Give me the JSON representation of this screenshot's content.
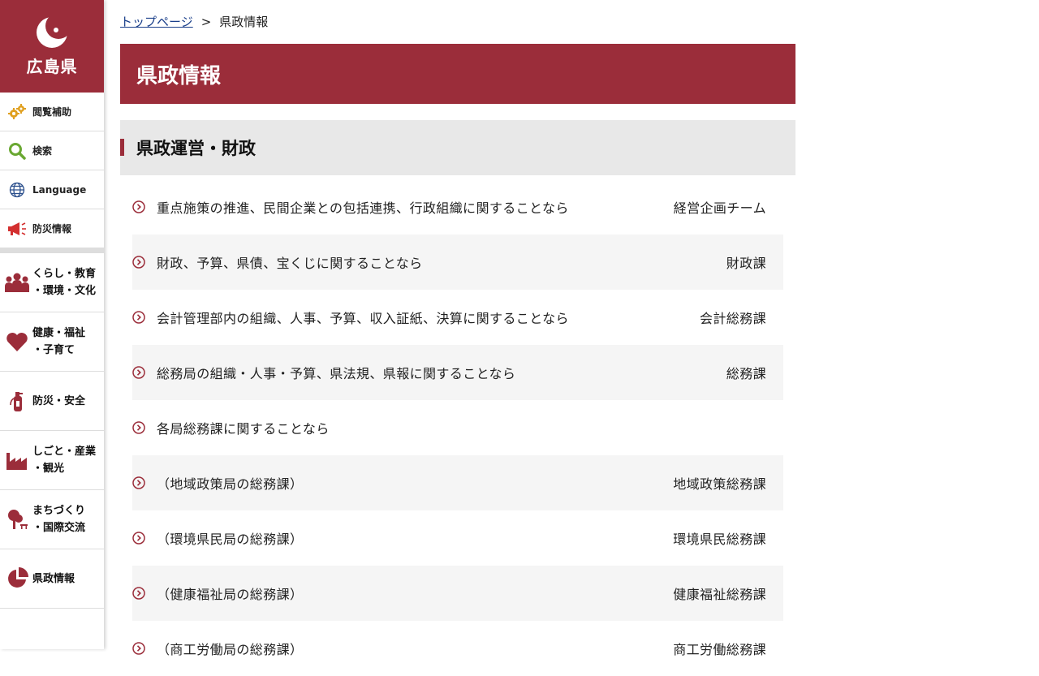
{
  "logo": {
    "name": "広島県"
  },
  "util_nav": [
    {
      "label": "閲覧補助",
      "icon": "gear-icon"
    },
    {
      "label": "検索",
      "icon": "search-icon"
    },
    {
      "label": "Language",
      "icon": "globe-icon"
    },
    {
      "label": "防災情報",
      "icon": "megaphone-icon"
    }
  ],
  "main_nav": [
    {
      "label": "くらし・教育\n・環境・文化",
      "icon": "people-icon"
    },
    {
      "label": "健康・福祉\n・子育て",
      "icon": "heart-icon"
    },
    {
      "label": "防災・安全",
      "icon": "extinguisher-icon"
    },
    {
      "label": "しごと・産業\n・観光",
      "icon": "factory-icon"
    },
    {
      "label": "まちづくり\n・国際交流",
      "icon": "tree-icon"
    },
    {
      "label": "県政情報",
      "icon": "pie-icon"
    }
  ],
  "breadcrumb": {
    "home": "トップページ",
    "separator": ">",
    "current": "県政情報"
  },
  "page_title": "県政情報",
  "section_title": "県政運営・財政",
  "rows": [
    {
      "text": "重点施策の推進、民間企業との包括連携、行政組織に関することなら",
      "dept": "経営企画チーム"
    },
    {
      "text": "財政、予算、県債、宝くじに関することなら",
      "dept": "財政課"
    },
    {
      "text": "会計管理部内の組織、人事、予算、収入証紙、決算に関することなら",
      "dept": "会計総務課"
    },
    {
      "text": "総務局の組織・人事・予算、県法規、県報に関することなら",
      "dept": "総務課"
    },
    {
      "text": "各局総務課に関することなら",
      "dept": ""
    },
    {
      "text": "（地域政策局の総務課）",
      "dept": "地域政策総務課"
    },
    {
      "text": "（環境県民局の総務課）",
      "dept": "環境県民総務課"
    },
    {
      "text": "（健康福祉局の総務課）",
      "dept": "健康福祉総務課"
    },
    {
      "text": "（商工労働局の総務課）",
      "dept": "商工労働総務課"
    }
  ],
  "colors": {
    "brand": "#9b2d3a",
    "link": "#1a3f8a"
  }
}
